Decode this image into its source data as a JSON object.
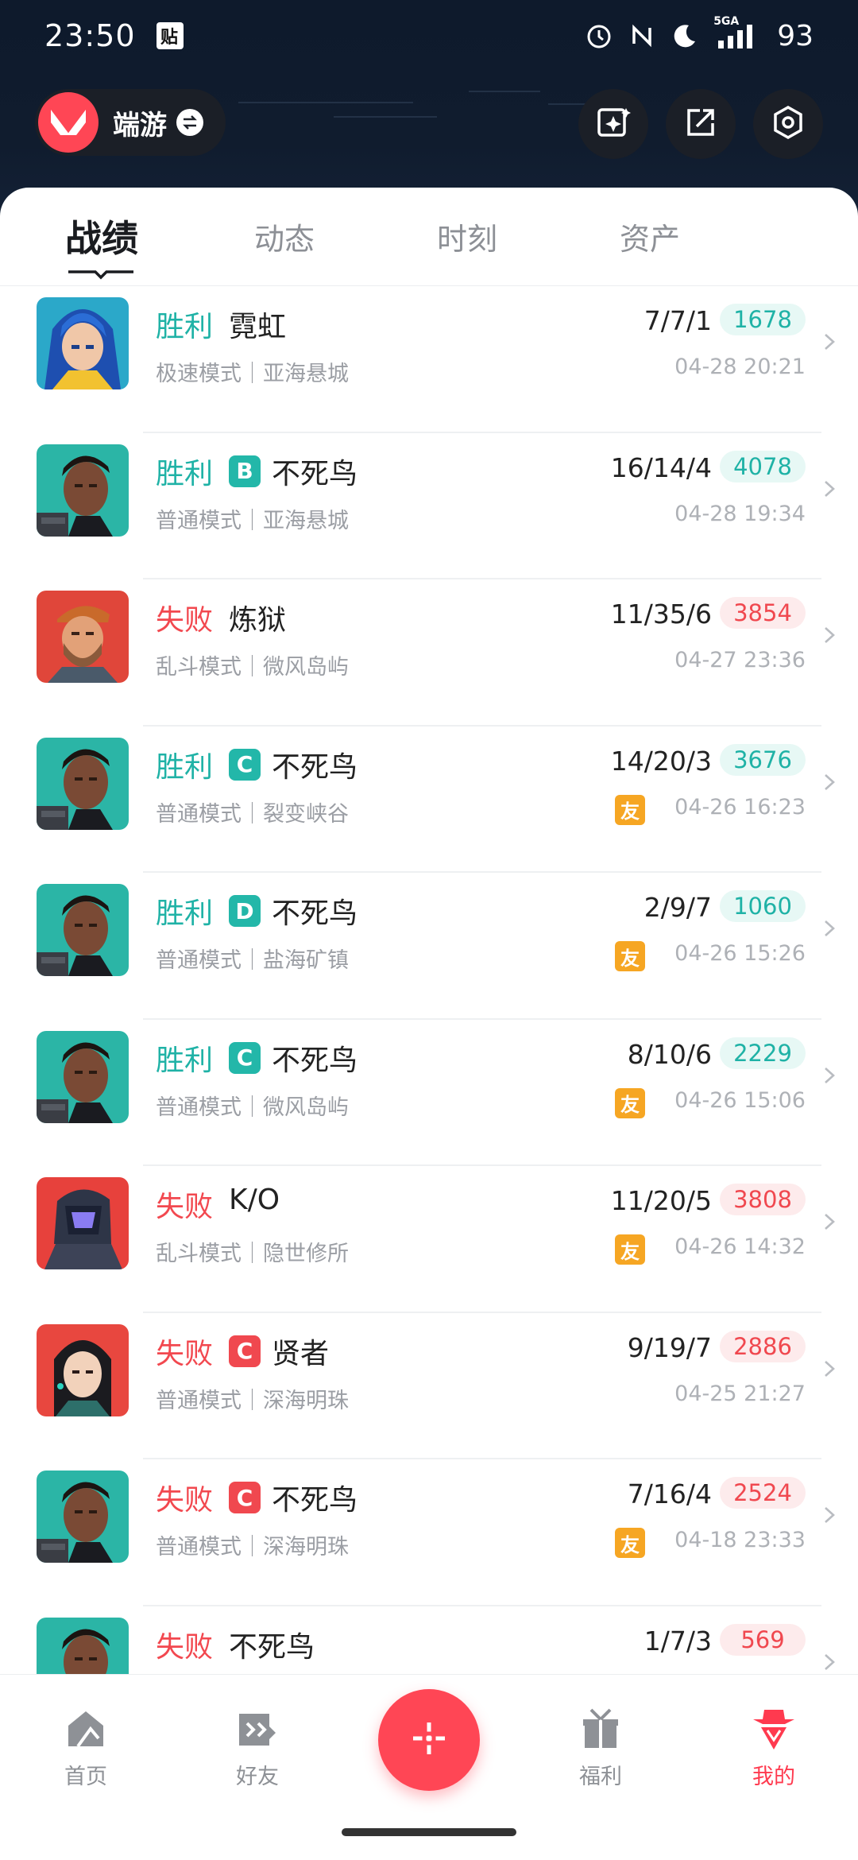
{
  "status_bar": {
    "time": "23:50",
    "sticker": "贴",
    "network": "5GA",
    "battery": "93",
    "icons": [
      "alarm-icon",
      "nfc-icon",
      "moon-icon",
      "signal-icon"
    ]
  },
  "header": {
    "game_name": "端游",
    "game_logo": "valorant-logo",
    "swap_icon": "swap-icon",
    "buttons": [
      "sparkle-card-icon",
      "share-icon",
      "settings-hex-icon"
    ]
  },
  "tabs": [
    {
      "label": "战绩",
      "active": true
    },
    {
      "label": "动态",
      "active": false
    },
    {
      "label": "时刻",
      "active": false
    },
    {
      "label": "资产",
      "active": false
    }
  ],
  "matches": [
    {
      "result": "胜利",
      "outcome": "win",
      "grade": "",
      "hero": "霓虹",
      "mode": "极速模式｜亚海悬城",
      "kda": "7/7/1",
      "score": "1678",
      "friend": false,
      "time": "04-28 20:21",
      "avatar": "neon"
    },
    {
      "result": "胜利",
      "outcome": "win",
      "grade": "B",
      "hero": "不死鸟",
      "mode": "普通模式｜亚海悬城",
      "kda": "16/14/4",
      "score": "4078",
      "friend": false,
      "time": "04-28 19:34",
      "avatar": "phoenix"
    },
    {
      "result": "失败",
      "outcome": "lose",
      "grade": "",
      "hero": "炼狱",
      "mode": "乱斗模式｜微风岛屿",
      "kda": "11/35/6",
      "score": "3854",
      "friend": false,
      "time": "04-27 23:36",
      "avatar": "brimstone"
    },
    {
      "result": "胜利",
      "outcome": "win",
      "grade": "C",
      "hero": "不死鸟",
      "mode": "普通模式｜裂变峡谷",
      "kda": "14/20/3",
      "score": "3676",
      "friend": true,
      "time": "04-26 16:23",
      "avatar": "phoenix"
    },
    {
      "result": "胜利",
      "outcome": "win",
      "grade": "D",
      "hero": "不死鸟",
      "mode": "普通模式｜盐海矿镇",
      "kda": "2/9/7",
      "score": "1060",
      "friend": true,
      "time": "04-26 15:26",
      "avatar": "phoenix"
    },
    {
      "result": "胜利",
      "outcome": "win",
      "grade": "C",
      "hero": "不死鸟",
      "mode": "普通模式｜微风岛屿",
      "kda": "8/10/6",
      "score": "2229",
      "friend": true,
      "time": "04-26 15:06",
      "avatar": "phoenix"
    },
    {
      "result": "失败",
      "outcome": "lose",
      "grade": "",
      "hero": "K/O",
      "mode": "乱斗模式｜隐世修所",
      "kda": "11/20/5",
      "score": "3808",
      "friend": true,
      "time": "04-26 14:32",
      "avatar": "kayo"
    },
    {
      "result": "失败",
      "outcome": "lose",
      "grade": "C",
      "hero": "贤者",
      "mode": "普通模式｜深海明珠",
      "kda": "9/19/7",
      "score": "2886",
      "friend": false,
      "time": "04-25 21:27",
      "avatar": "sage"
    },
    {
      "result": "失败",
      "outcome": "lose",
      "grade": "C",
      "hero": "不死鸟",
      "mode": "普通模式｜深海明珠",
      "kda": "7/16/4",
      "score": "2524",
      "friend": true,
      "time": "04-18 23:33",
      "avatar": "phoenix"
    },
    {
      "result": "失败",
      "outcome": "lose",
      "grade": "",
      "hero": "不死鸟",
      "mode": "",
      "kda": "1/7/3",
      "score": "569",
      "friend": true,
      "time": "",
      "avatar": "phoenix"
    }
  ],
  "friend_badge_label": "友",
  "bottom_nav": {
    "items": [
      {
        "label": "首页",
        "icon": "home-icon",
        "active": false
      },
      {
        "label": "好友",
        "icon": "friends-icon",
        "active": false
      },
      {
        "label": "福利",
        "icon": "gift-icon",
        "active": false
      },
      {
        "label": "我的",
        "icon": "profile-agent-icon",
        "active": true
      }
    ],
    "fab_icon": "plus-icon"
  },
  "colors": {
    "accent": "#ff4655",
    "win": "#1fb2a6",
    "lose": "#f0484f",
    "friend_badge": "#f6a623"
  }
}
